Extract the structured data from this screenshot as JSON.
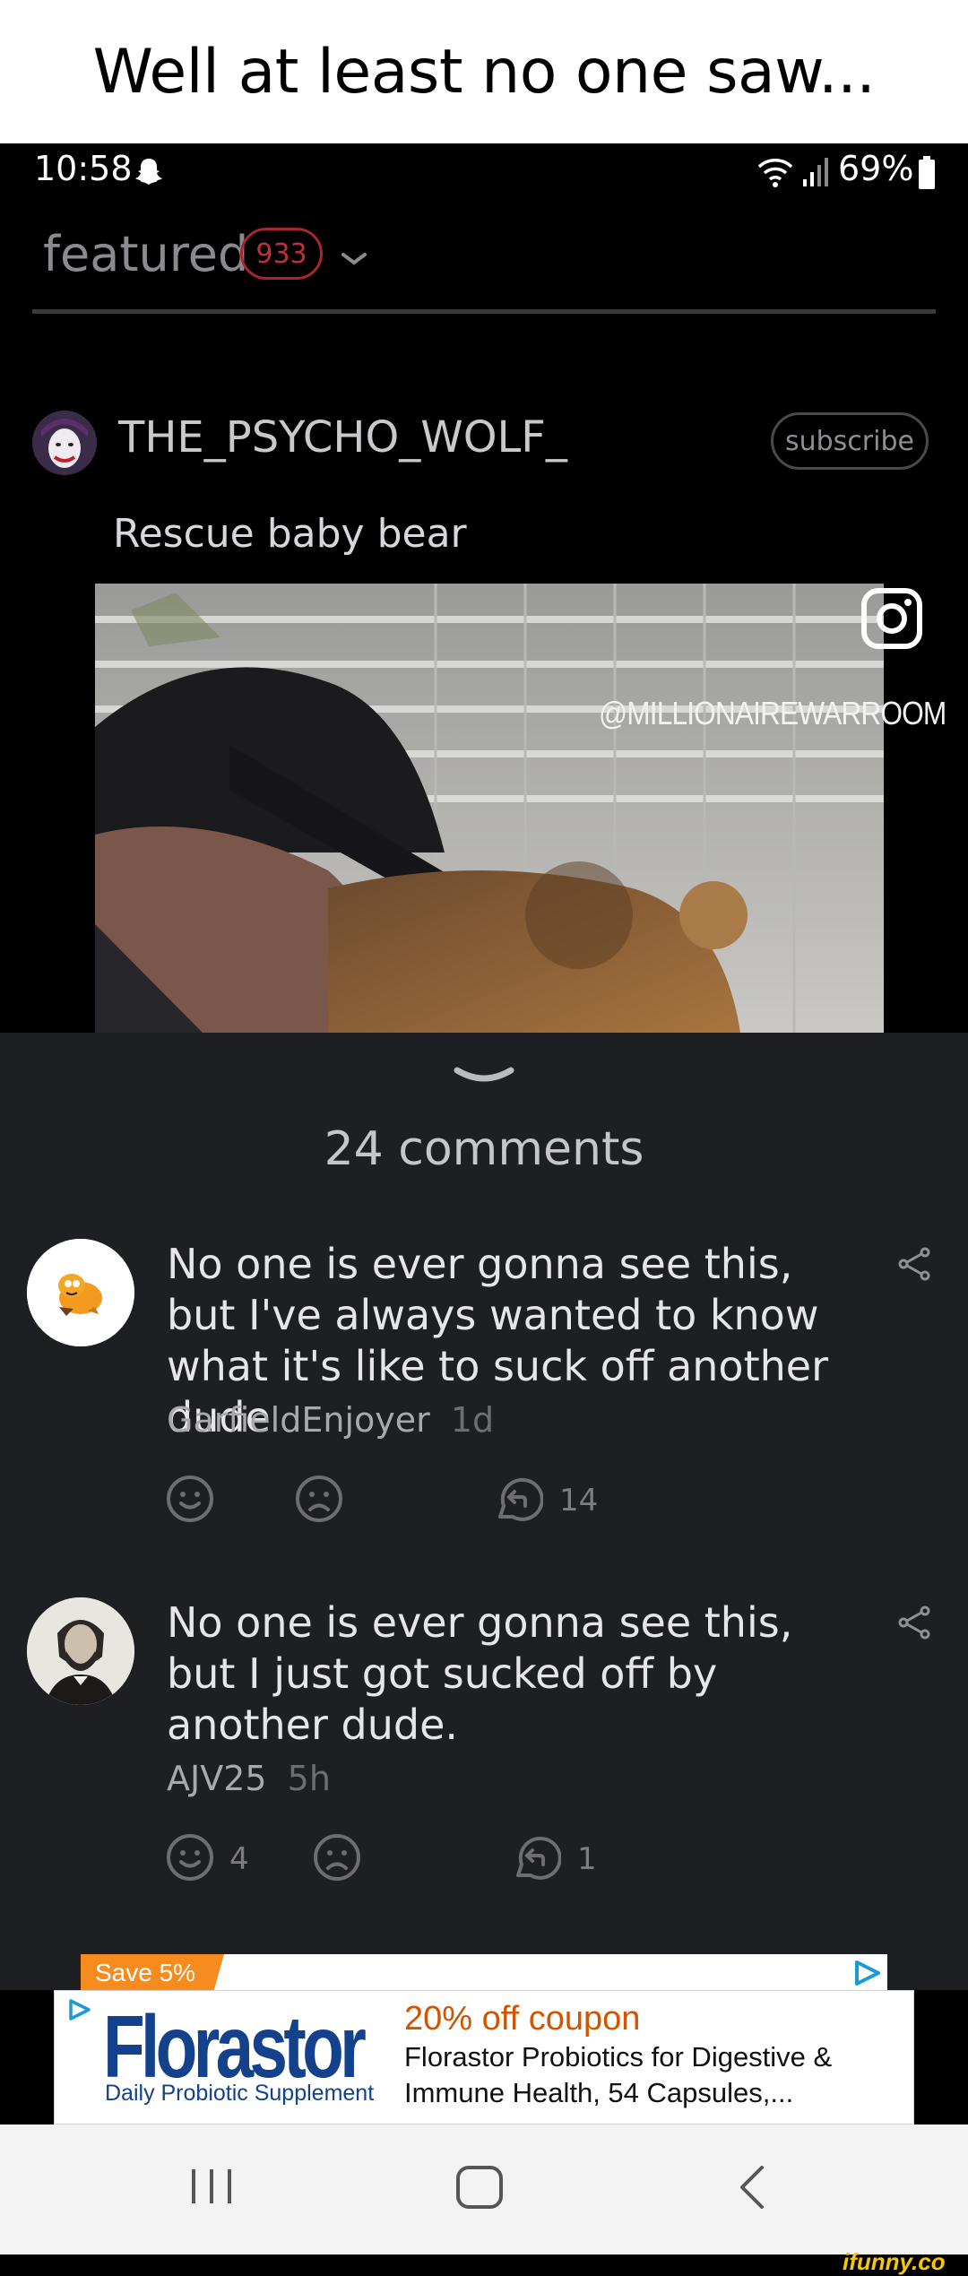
{
  "caption": {
    "text": "Well at least no one saw..."
  },
  "status_bar": {
    "time": "10:58",
    "battery": "69%",
    "icons": [
      "snapchat-ghost-icon",
      "wifi-icon",
      "signal-icon",
      "battery-icon"
    ]
  },
  "feed": {
    "title": "featured",
    "badge_count": "933",
    "accent_color": "#c0303a"
  },
  "post": {
    "author": "THE_PSYCHO_WOLF_",
    "subscribe_label": "subscribe",
    "title": "Rescue baby bear",
    "media_watermark": "@MILLIONAIREWARROOM"
  },
  "comments": {
    "count_label": "24 comments",
    "items": [
      {
        "text": "No one is ever gonna see this, but I've always wanted to know what it's like to suck off another dude",
        "user": "GarfieldEnjoyer",
        "time": "1d",
        "likes": "",
        "replies": "14"
      },
      {
        "text": "No one is ever gonna see this, but I just got sucked off by another dude.",
        "user": "AJV25",
        "time": "5h",
        "likes": "4",
        "replies": "1"
      }
    ]
  },
  "ad": {
    "save_tag": "Save 5%",
    "brand": "Florastor",
    "brand_sub": "Daily Probiotic Supplement",
    "headline": "20% off coupon",
    "description": "Florastor Probiotics for Digestive & Immune Health, 54 Capsules,...",
    "brand_color": "#13418c",
    "headline_color": "#d35400"
  },
  "watermark": {
    "site": "ifunny.co"
  }
}
